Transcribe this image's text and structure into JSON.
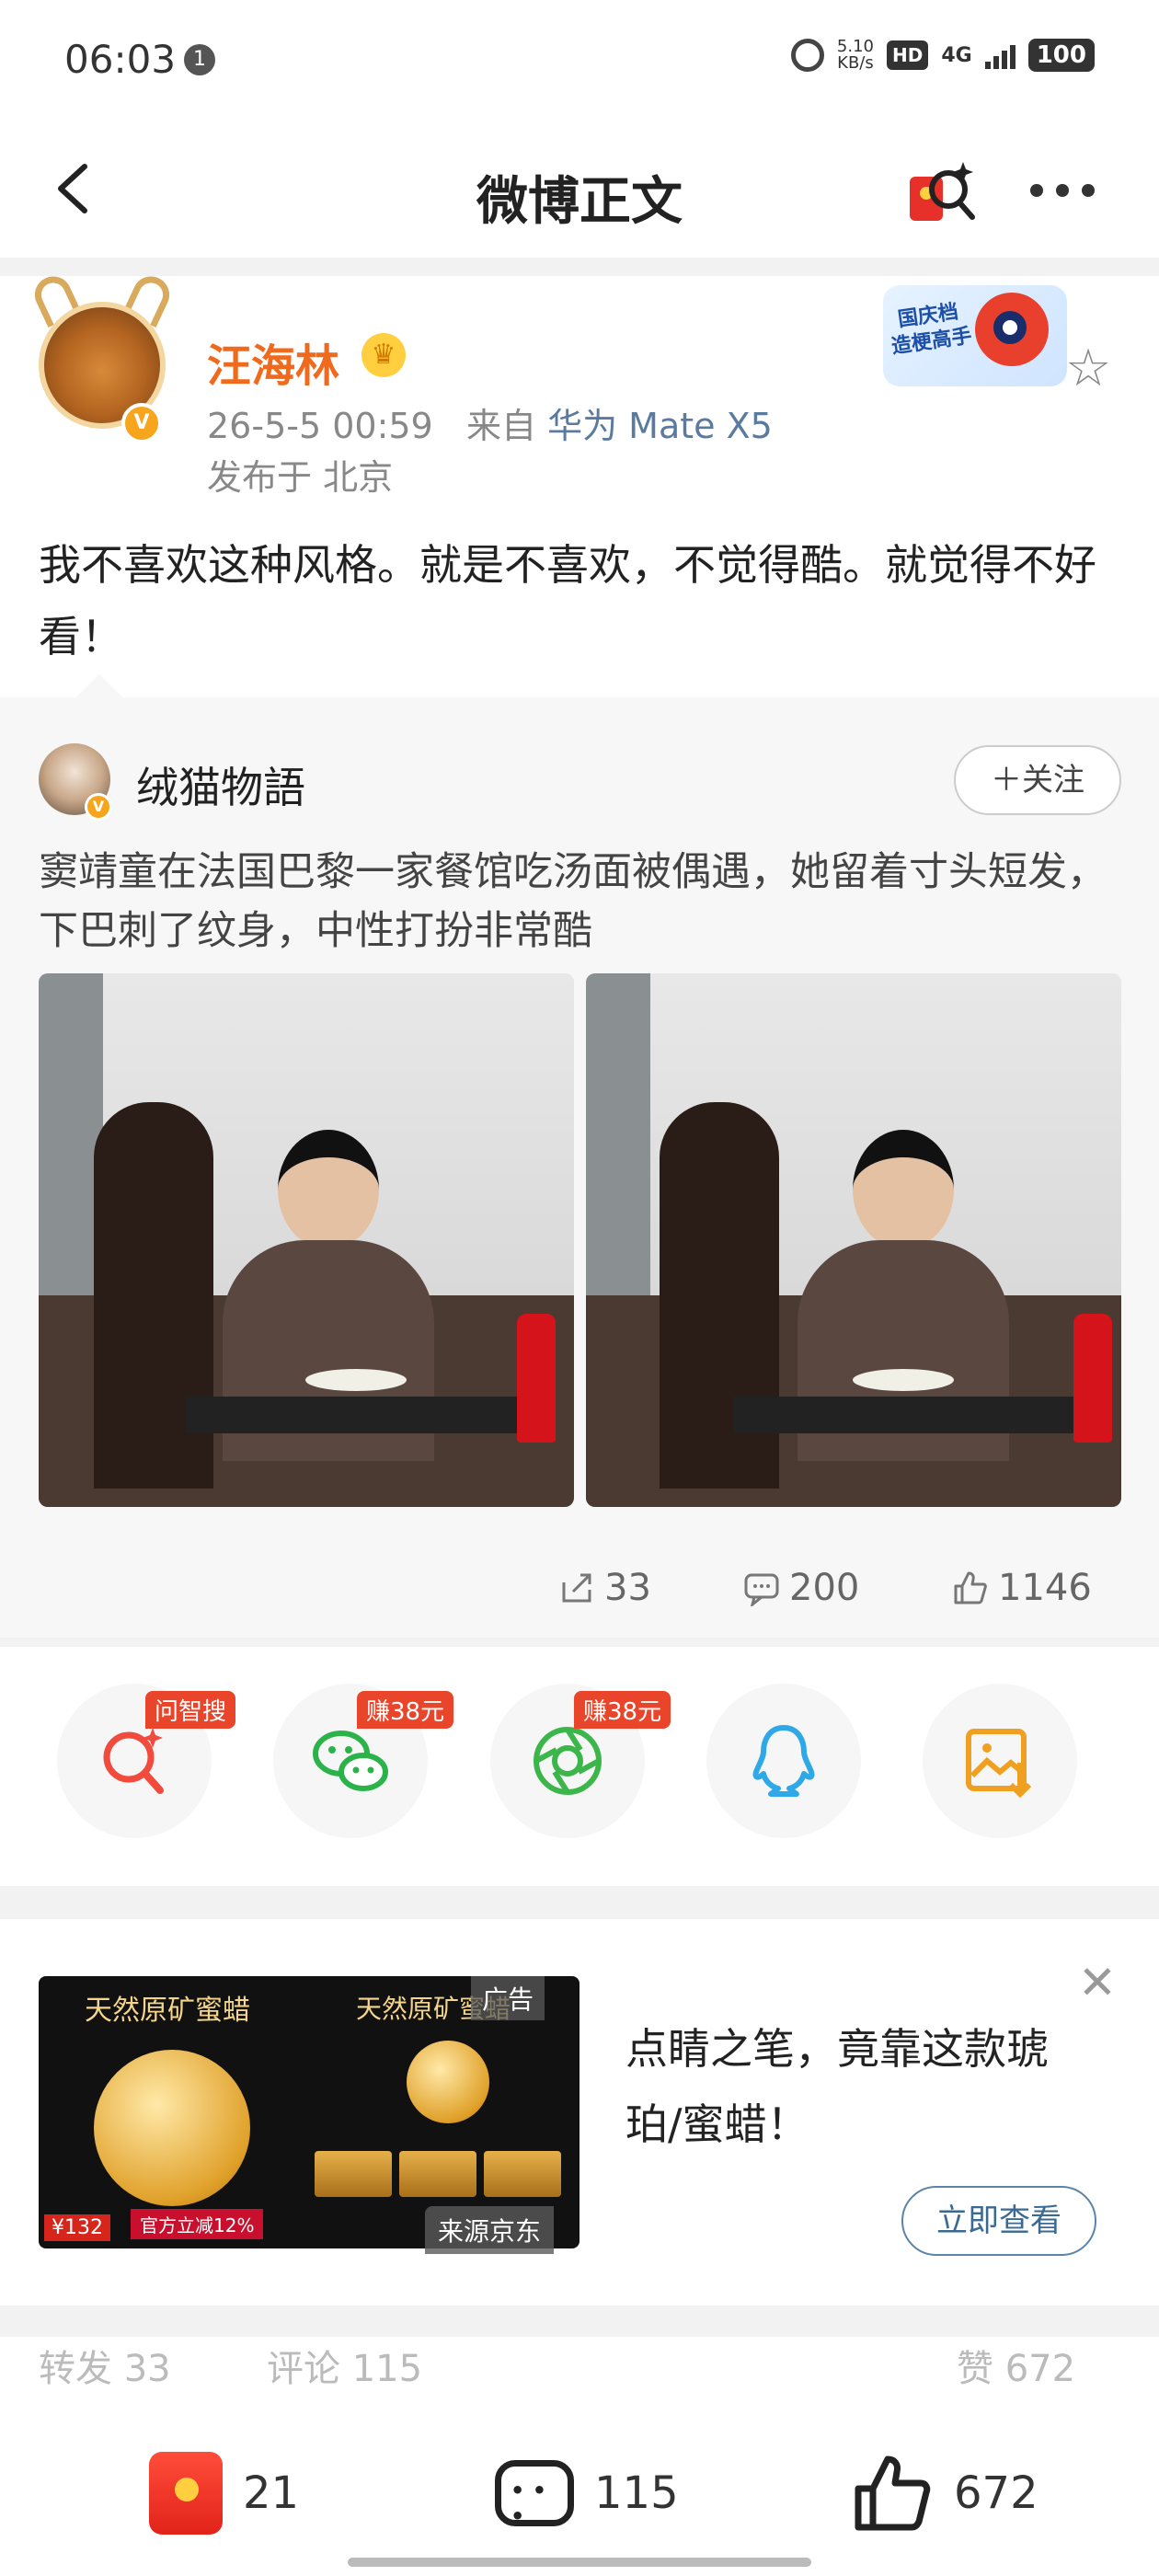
{
  "status_bar": {
    "time": "06:03",
    "notification_count": "1",
    "speed": "5.10",
    "speed_unit": "KB/s",
    "hd": "HD",
    "network": "4G",
    "battery": "100"
  },
  "nav": {
    "title": "微博正文"
  },
  "post": {
    "username": "汪海林",
    "date": "26-5-5 00:59",
    "source_prefix": "来自",
    "device": "华为 Mate X5",
    "location": "发布于 北京",
    "badge_text": "国庆档 造梗高手",
    "text": "我不喜欢这种风格。就是不喜欢，不觉得酷。就觉得不好看！"
  },
  "repost": {
    "username": "绒猫物語",
    "follow_label": "＋关注",
    "text": "窦靖童在法国巴黎一家餐馆吃汤面被偶遇，她留着寸头短发，下巴刺了纹身，中性打扮非常酷",
    "stats": {
      "reposts": "33",
      "comments": "200",
      "likes": "1146"
    }
  },
  "share": {
    "items": [
      {
        "icon": "ai-search-icon",
        "tag": "问智搜",
        "color": "#f04b3c"
      },
      {
        "icon": "wechat-icon",
        "tag": "赚38元",
        "color": "#2bb34a"
      },
      {
        "icon": "moments-icon",
        "tag": "赚38元",
        "color": "#3cb54a"
      },
      {
        "icon": "qq-icon",
        "tag": "",
        "color": "#2fa8e8"
      },
      {
        "icon": "save-image-icon",
        "tag": "",
        "color": "#f0a020"
      }
    ]
  },
  "ad": {
    "label": "广告",
    "image_title_left": "天然原矿蜜蜡",
    "image_title_right": "天然原矿蜜蜡",
    "price": "¥132",
    "promo": "官方立减12%",
    "source": "来源京东",
    "title": "点睛之笔，竟靠这款琥珀/蜜蜡！",
    "button": "立即查看"
  },
  "tabs_peek": {
    "left": "转发 33",
    "middle": "评论 115",
    "right": "赞 672"
  },
  "bottom_bar": {
    "redpacket_count": "21",
    "comments_count": "115",
    "likes_count": "672"
  },
  "colors": {
    "accent_orange": "#f06a1e",
    "link_blue": "#5a7aa0"
  }
}
